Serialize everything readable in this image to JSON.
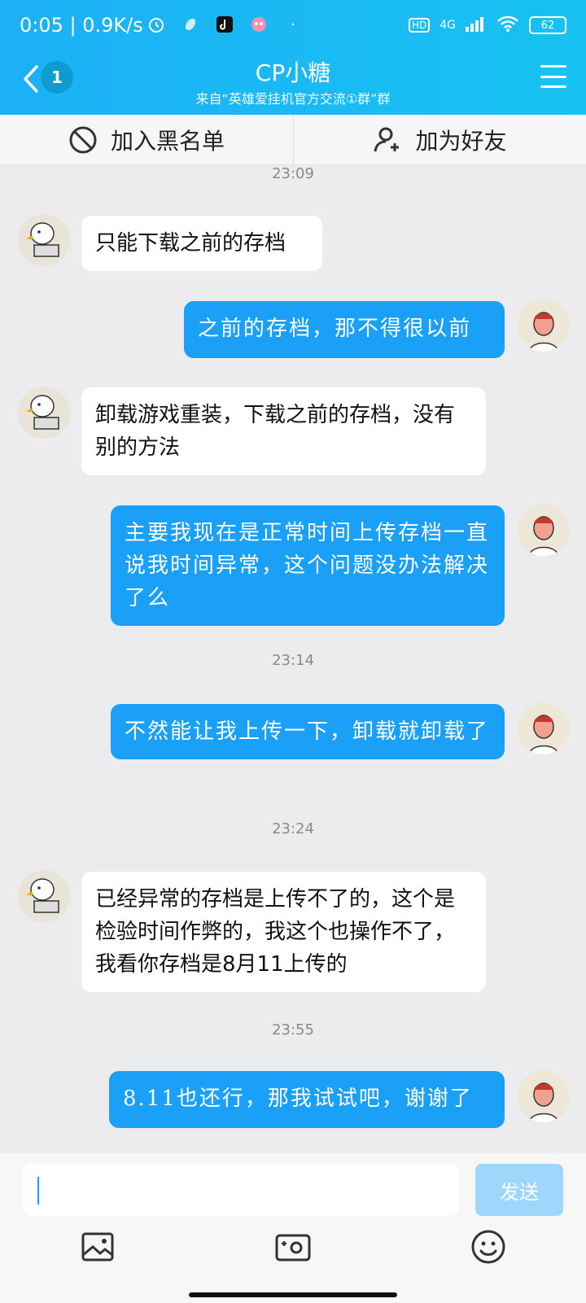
{
  "status": {
    "time_text": "0:05 | 0.9K/s",
    "network": "4G",
    "battery": "62"
  },
  "header": {
    "back_count": "1",
    "title": "CP小糖",
    "subtitle": "来自“英雄爱挂机官方交流①群”群"
  },
  "actions": {
    "block_label": "加入黑名单",
    "add_friend_label": "加为好友"
  },
  "messages": [
    {
      "type": "time",
      "text": "23:09"
    },
    {
      "type": "in",
      "text": "只能下载之前的存档"
    },
    {
      "type": "out",
      "text": "之前的存档，那不得很以前"
    },
    {
      "type": "in",
      "text": "卸载游戏重装，下载之前的存档，没有别的方法"
    },
    {
      "type": "out",
      "text": "主要我现在是正常时间上传存档一直说我时间异常，这个问题没办法解决了么"
    },
    {
      "type": "time",
      "text": "23:14"
    },
    {
      "type": "out",
      "text": "不然能让我上传一下，卸载就卸载了"
    },
    {
      "type": "time",
      "text": "23:24"
    },
    {
      "type": "in",
      "text": "已经异常的存档是上传不了的，这个是检验时间作弊的，我这个也操作不了，我看你存档是8月11上传的"
    },
    {
      "type": "time",
      "text": "23:55"
    },
    {
      "type": "out",
      "text": "8.11也还行，那我试试吧，谢谢了"
    }
  ],
  "input": {
    "value": "",
    "send_label": "发送"
  },
  "colors": {
    "header": "#1cb0f6",
    "out_bubble": "#1aa0f7",
    "send_disabled": "#9fd6fb"
  },
  "icons": [
    "back-icon",
    "menu-icon",
    "block-icon",
    "add-friend-icon",
    "image-icon",
    "camera-icon",
    "emoji-icon"
  ]
}
